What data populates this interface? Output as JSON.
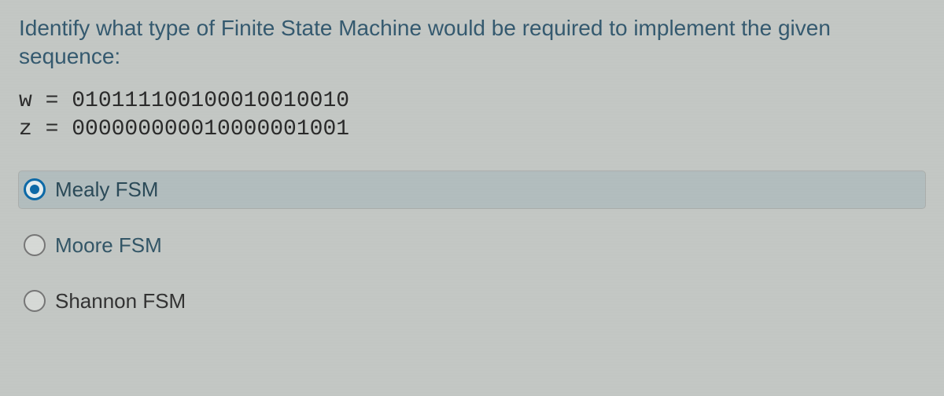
{
  "question": {
    "prompt": "Identify what type of Finite State Machine would be required to implement the given sequence:",
    "w_line": "w = 010111100100010010010",
    "z_line": "z  = 000000000010000001001"
  },
  "options": [
    {
      "id": "mealy",
      "label": "Mealy FSM",
      "selected": true
    },
    {
      "id": "moore",
      "label": "Moore FSM",
      "selected": false
    },
    {
      "id": "shannon",
      "label": "Shannon FSM",
      "selected": false
    }
  ]
}
